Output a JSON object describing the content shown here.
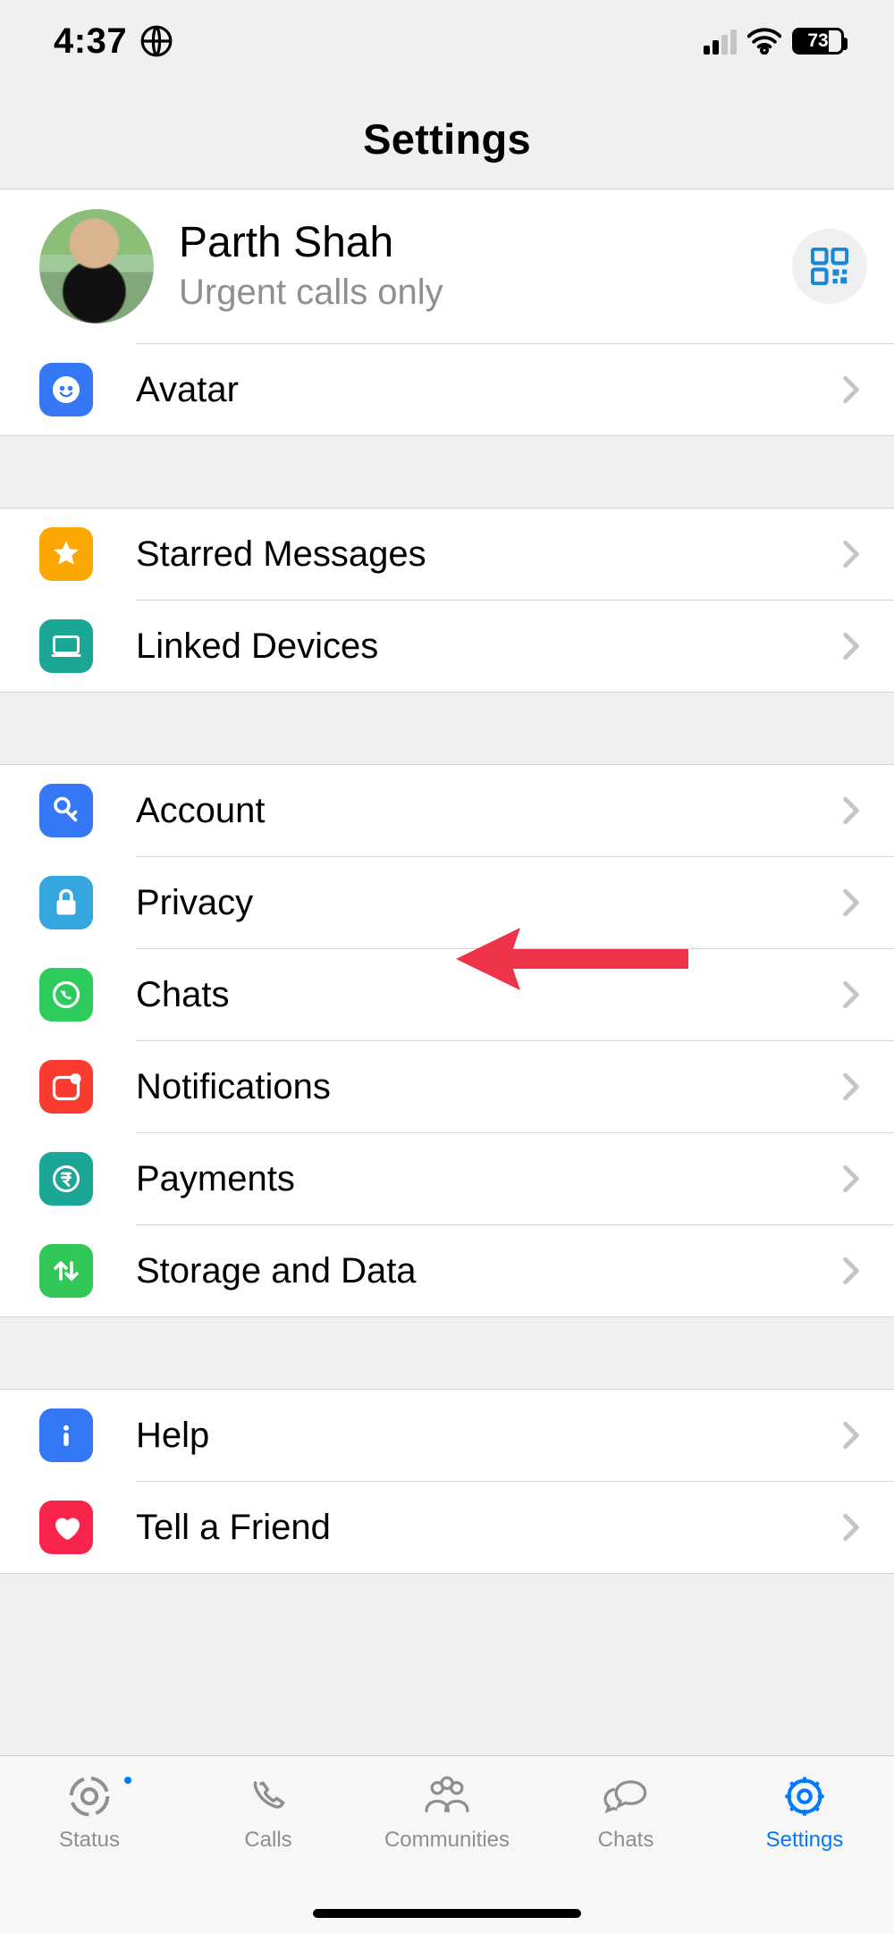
{
  "status": {
    "time": "4:37",
    "battery_percent": "73"
  },
  "header": {
    "title": "Settings"
  },
  "profile": {
    "name": "Parth Shah",
    "subtitle": "Urgent calls only"
  },
  "rows": {
    "avatar": "Avatar",
    "starred": "Starred Messages",
    "linked": "Linked Devices",
    "account": "Account",
    "privacy": "Privacy",
    "chats": "Chats",
    "notifications": "Notifications",
    "payments": "Payments",
    "storage": "Storage and Data",
    "help": "Help",
    "tell": "Tell a Friend"
  },
  "tabs": {
    "status": "Status",
    "calls": "Calls",
    "communities": "Communities",
    "chats": "Chats",
    "settings": "Settings"
  },
  "annotation": {
    "points_to": "storage"
  }
}
